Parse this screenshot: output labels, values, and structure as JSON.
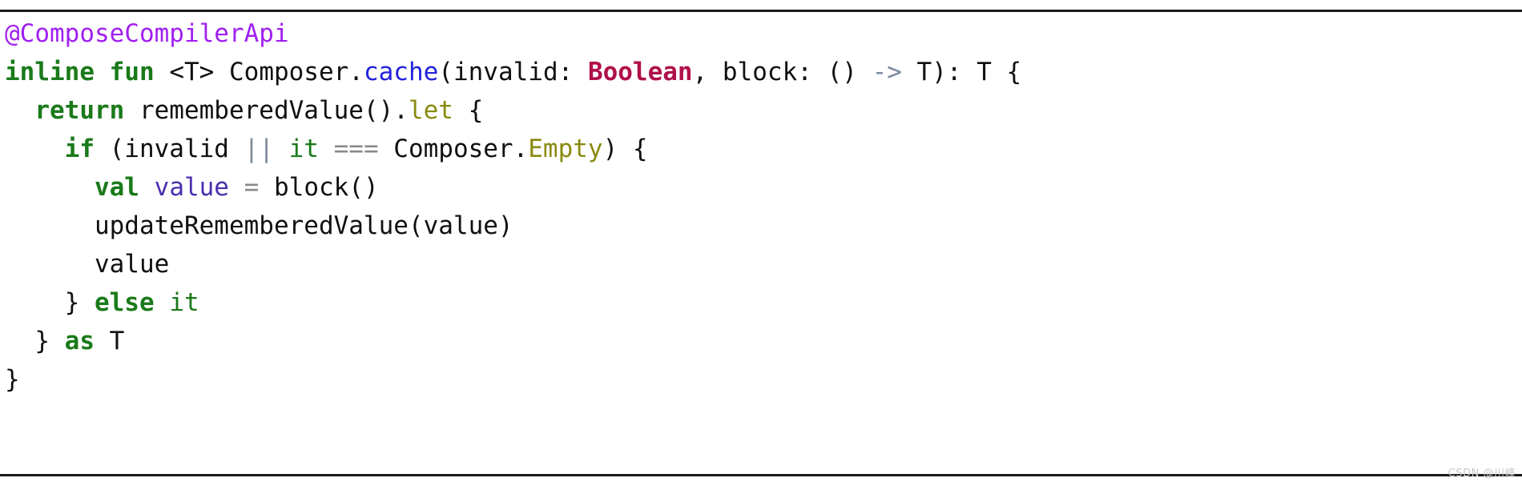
{
  "code_block": {
    "language": "kotlin",
    "background_color": "#ffffff",
    "rule_color": "#1a1a1a",
    "palette": {
      "annotation": "#a020f0",
      "keyword": "#1a7a1a",
      "function": "#2222dd",
      "type": "#b0104a",
      "member": "#8a8a10",
      "operator": "#8a8a8a",
      "soft_operator": "#7a8a9a",
      "local_variable": "#4b2fae",
      "plain": "#101010"
    },
    "lines": [
      {
        "indent": 0,
        "tokens": [
          {
            "text": "@ComposeCompilerApi",
            "kind": "annotation"
          }
        ]
      },
      {
        "indent": 0,
        "tokens": [
          {
            "text": "inline",
            "kind": "keyword"
          },
          {
            "text": " ",
            "kind": "plain"
          },
          {
            "text": "fun",
            "kind": "keyword"
          },
          {
            "text": " ",
            "kind": "plain"
          },
          {
            "text": "<T>",
            "kind": "generic"
          },
          {
            "text": " Composer.",
            "kind": "plain"
          },
          {
            "text": "cache",
            "kind": "function"
          },
          {
            "text": "(invalid: ",
            "kind": "plain"
          },
          {
            "text": "Boolean",
            "kind": "type"
          },
          {
            "text": ", block: () ",
            "kind": "plain"
          },
          {
            "text": "->",
            "kind": "soft"
          },
          {
            "text": " T): T {",
            "kind": "plain"
          }
        ]
      },
      {
        "indent": 1,
        "tokens": [
          {
            "text": "return",
            "kind": "keyword"
          },
          {
            "text": " rememberedValue().",
            "kind": "plain"
          },
          {
            "text": "let",
            "kind": "member"
          },
          {
            "text": " {",
            "kind": "plain"
          }
        ]
      },
      {
        "indent": 2,
        "tokens": [
          {
            "text": "if",
            "kind": "keyword"
          },
          {
            "text": " (invalid ",
            "kind": "plain"
          },
          {
            "text": "||",
            "kind": "soft"
          },
          {
            "text": " ",
            "kind": "plain"
          },
          {
            "text": "it",
            "kind": "itkw"
          },
          {
            "text": " ",
            "kind": "plain"
          },
          {
            "text": "===",
            "kind": "operator"
          },
          {
            "text": " Composer.",
            "kind": "plain"
          },
          {
            "text": "Empty",
            "kind": "member"
          },
          {
            "text": ") {",
            "kind": "plain"
          }
        ]
      },
      {
        "indent": 3,
        "tokens": [
          {
            "text": "val",
            "kind": "keyword"
          },
          {
            "text": " ",
            "kind": "plain"
          },
          {
            "text": "value",
            "kind": "local"
          },
          {
            "text": " ",
            "kind": "plain"
          },
          {
            "text": "=",
            "kind": "operator"
          },
          {
            "text": " block()",
            "kind": "plain"
          }
        ]
      },
      {
        "indent": 3,
        "tokens": [
          {
            "text": "updateRememberedValue(value)",
            "kind": "plain"
          }
        ]
      },
      {
        "indent": 3,
        "tokens": [
          {
            "text": "value",
            "kind": "plain"
          }
        ]
      },
      {
        "indent": 2,
        "tokens": [
          {
            "text": "} ",
            "kind": "plain"
          },
          {
            "text": "else",
            "kind": "keyword"
          },
          {
            "text": " ",
            "kind": "plain"
          },
          {
            "text": "it",
            "kind": "itkw"
          }
        ]
      },
      {
        "indent": 1,
        "tokens": [
          {
            "text": "} ",
            "kind": "plain"
          },
          {
            "text": "as",
            "kind": "keyword"
          },
          {
            "text": " T",
            "kind": "plain"
          }
        ]
      },
      {
        "indent": 0,
        "tokens": [
          {
            "text": "}",
            "kind": "plain"
          }
        ]
      }
    ]
  },
  "watermark": {
    "text": "CSDN @川峰"
  }
}
